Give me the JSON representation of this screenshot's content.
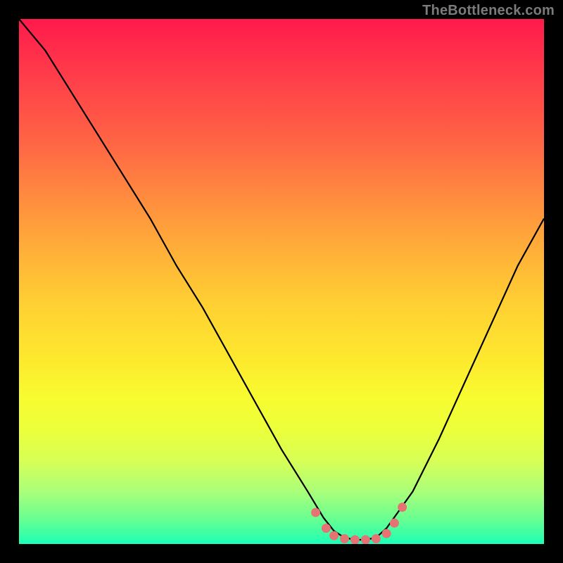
{
  "watermark": "TheBottleneck.com",
  "colors": {
    "frame": "#000000",
    "gradient_top": "#ff1a4c",
    "gradient_bottom": "#17ffbf",
    "curve": "#000000",
    "markers": "#e57373"
  },
  "chart_data": {
    "type": "line",
    "title": "",
    "xlabel": "",
    "ylabel": "",
    "xlim": [
      0,
      100
    ],
    "ylim": [
      0,
      100
    ],
    "grid": false,
    "legend": false,
    "annotations": [],
    "series": [
      {
        "name": "bottleneck-curve",
        "x": [
          0,
          5,
          10,
          15,
          20,
          25,
          30,
          35,
          40,
          45,
          50,
          55,
          58,
          60,
          62,
          64,
          66,
          68,
          70,
          75,
          80,
          85,
          90,
          95,
          100
        ],
        "values": [
          100,
          94,
          86,
          78,
          70,
          62,
          53,
          45,
          36,
          27,
          18,
          10,
          5,
          2.5,
          1.2,
          0.8,
          0.8,
          1.2,
          3,
          10,
          20,
          31,
          42,
          53,
          62
        ]
      }
    ],
    "markers": [
      {
        "x": 56.5,
        "y": 6.0
      },
      {
        "x": 58.5,
        "y": 3.0
      },
      {
        "x": 60.0,
        "y": 1.6
      },
      {
        "x": 62.0,
        "y": 1.0
      },
      {
        "x": 64.0,
        "y": 0.8
      },
      {
        "x": 66.0,
        "y": 0.8
      },
      {
        "x": 68.0,
        "y": 1.0
      },
      {
        "x": 70.0,
        "y": 2.0
      },
      {
        "x": 71.5,
        "y": 4.0
      },
      {
        "x": 73.0,
        "y": 7.0
      }
    ]
  }
}
